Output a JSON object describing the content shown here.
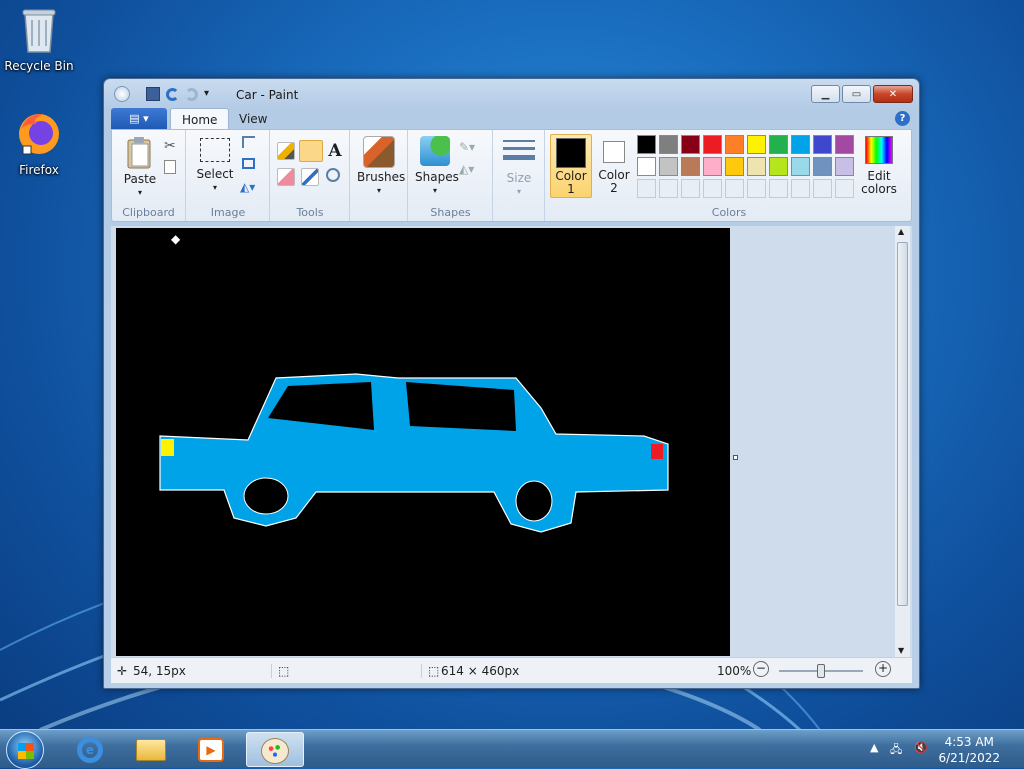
{
  "desktop": {
    "icons": [
      {
        "label": "Recycle Bin",
        "icon": "recycle-bin-icon"
      },
      {
        "label": "Firefox",
        "icon": "firefox-icon"
      }
    ]
  },
  "window": {
    "title": "Car - Paint",
    "file_tab": "▤ ▾",
    "tabs": [
      "Home",
      "View"
    ],
    "help": "?"
  },
  "ribbon": {
    "clipboard": {
      "paste": "Paste",
      "group": "Clipboard"
    },
    "image": {
      "select": "Select",
      "group": "Image"
    },
    "tools": {
      "group": "Tools"
    },
    "brushes": {
      "label": "Brushes"
    },
    "shapes": {
      "label": "Shapes",
      "group": "Shapes"
    },
    "size": {
      "label": "Size"
    },
    "colors": {
      "color1": "Color\n1",
      "color1_a": "Color",
      "color1_b": "1",
      "color2_a": "Color",
      "color2_b": "2",
      "edit_a": "Edit",
      "edit_b": "colors",
      "group": "Colors",
      "primary": "#000000",
      "secondary": "#ffffff",
      "palette_row1": [
        "#000000",
        "#7f7f7f",
        "#880015",
        "#ed1c24",
        "#ff7f27",
        "#fff200",
        "#22b14c",
        "#00a2e8",
        "#3f48cc",
        "#a349a4"
      ],
      "palette_row2": [
        "#ffffff",
        "#c3c3c3",
        "#b97a57",
        "#ffaec9",
        "#ffc90e",
        "#efe4b0",
        "#b5e61d",
        "#99d9ea",
        "#7092be",
        "#c8bfe7"
      ]
    }
  },
  "canvas": {
    "background": "#000000",
    "car_body": "#00a2e8",
    "headlight": "#fff200",
    "taillight": "#ed1c24"
  },
  "status": {
    "cursor_pos": "54, 15px",
    "canvas_size": "614 × 460px",
    "zoom": "100%"
  },
  "taskbar": {
    "time": "4:53 AM",
    "date": "6/21/2022"
  }
}
